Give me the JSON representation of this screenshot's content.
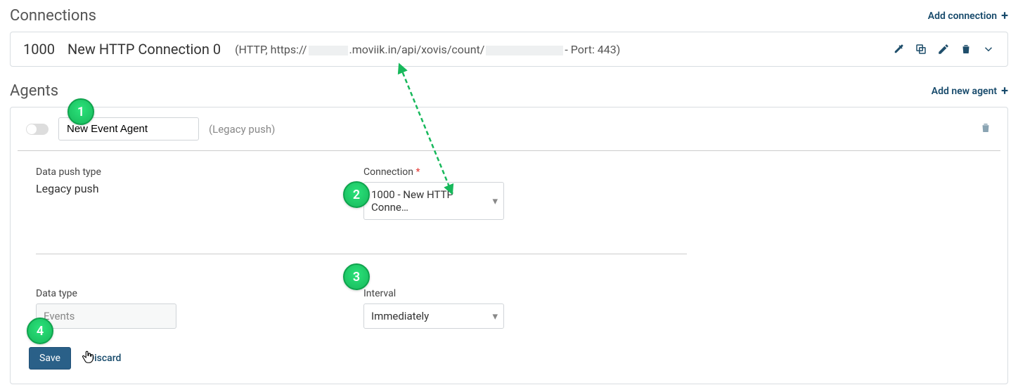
{
  "connections": {
    "title": "Connections",
    "add_label": "Add connection",
    "row": {
      "id": "1000",
      "name": "New HTTP Connection 0",
      "detail_prefix": "(HTTP, https://",
      "detail_mid_a": ".moviik.in/api/xovis/count/",
      "detail_suffix": " - Port: 443)"
    }
  },
  "agents": {
    "title": "Agents",
    "add_label": "Add new agent",
    "header": {
      "name_value": "New Event Agent",
      "legacy": "(Legacy push)"
    },
    "form": {
      "data_push_type_label": "Data push type",
      "data_push_type_value": "Legacy push",
      "connection_label": "Connection ",
      "connection_value": "1000 - New HTTP Conne…",
      "data_type_label": "Data type",
      "data_type_value": "Events",
      "interval_label": "Interval",
      "interval_value": "Immediately",
      "save_label": "Save",
      "discard_label": "Discard"
    }
  },
  "markers": {
    "m1": "1",
    "m2": "2",
    "m3": "3",
    "m4": "4"
  }
}
